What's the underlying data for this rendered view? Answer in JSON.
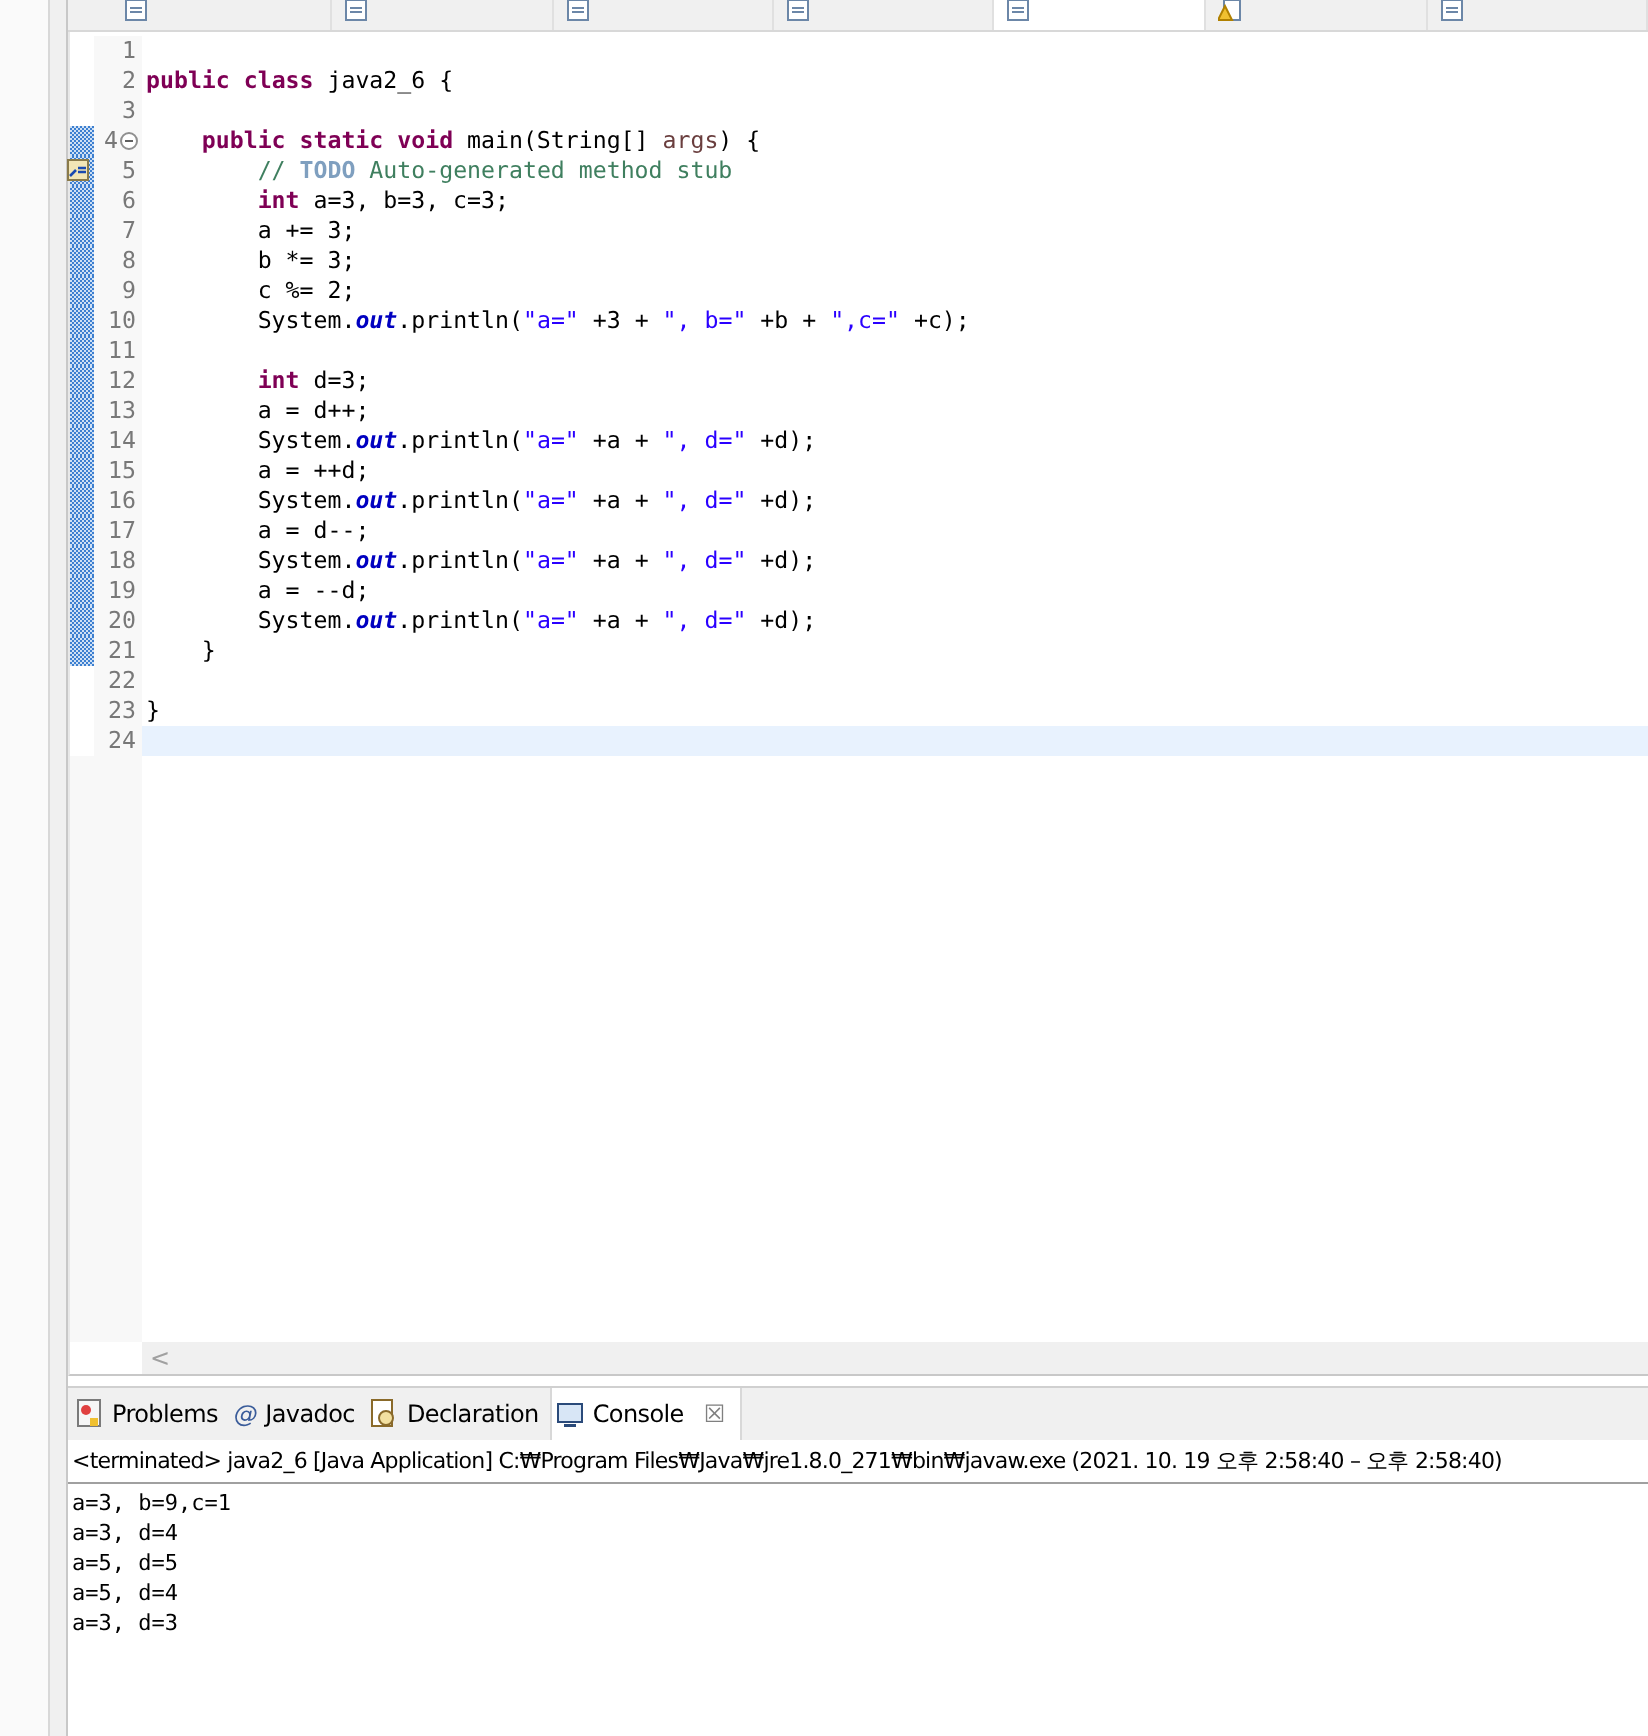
{
  "editor_tabs": [
    {
      "kind": "file",
      "selected": false
    },
    {
      "kind": "file",
      "selected": false
    },
    {
      "kind": "file",
      "selected": false
    },
    {
      "kind": "file",
      "selected": false
    },
    {
      "kind": "file",
      "selected": true
    },
    {
      "kind": "warning",
      "selected": false
    },
    {
      "kind": "file",
      "selected": false
    }
  ],
  "editor": {
    "lines": [
      {
        "number": "1",
        "changed": false,
        "current": false
      },
      {
        "number": "2",
        "changed": false,
        "current": false,
        "segments": [
          {
            "kind": "keyword",
            "text": "public class"
          },
          {
            "kind": "plain",
            "text": " java2_6 {"
          }
        ],
        "children": [
          {
            "number": "3",
            "changed": false,
            "current": false
          },
          {
            "number": "4",
            "changed": true,
            "current": false,
            "expanded": true,
            "segments": [
              {
                "kind": "keyword",
                "text": "public static void"
              },
              {
                "kind": "plain",
                "text": " main(String[] "
              },
              {
                "kind": "param",
                "text": "args"
              },
              {
                "kind": "plain",
                "text": ") {"
              }
            ],
            "children": [
              {
                "number": "5",
                "changed": true,
                "current": false,
                "task": true,
                "segments": [
                  {
                    "kind": "comment",
                    "text": "// "
                  },
                  {
                    "kind": "todo",
                    "text": "TODO"
                  },
                  {
                    "kind": "comment",
                    "text": " Auto-generated method stub"
                  }
                ]
              },
              {
                "number": "6",
                "changed": true,
                "current": false,
                "segments": [
                  {
                    "kind": "keyword",
                    "text": "int"
                  },
                  {
                    "kind": "plain",
                    "text": " a=3, b=3, c=3;"
                  }
                ]
              },
              {
                "number": "7",
                "changed": true,
                "current": false,
                "segments": [
                  {
                    "kind": "plain",
                    "text": "a += 3;"
                  }
                ]
              },
              {
                "number": "8",
                "changed": true,
                "current": false,
                "segments": [
                  {
                    "kind": "plain",
                    "text": "b *= 3;"
                  }
                ]
              },
              {
                "number": "9",
                "changed": true,
                "current": false,
                "segments": [
                  {
                    "kind": "plain",
                    "text": "c %= 2;"
                  }
                ]
              },
              {
                "number": "10",
                "changed": true,
                "current": false,
                "segments": [
                  {
                    "kind": "plain",
                    "text": "System."
                  },
                  {
                    "kind": "field",
                    "text": "out"
                  },
                  {
                    "kind": "plain",
                    "text": ".println("
                  },
                  {
                    "kind": "string",
                    "text": "\"a=\""
                  },
                  {
                    "kind": "plain",
                    "text": " +3 + "
                  },
                  {
                    "kind": "string",
                    "text": "\", b=\""
                  },
                  {
                    "kind": "plain",
                    "text": " +b + "
                  },
                  {
                    "kind": "string",
                    "text": "\",c=\""
                  },
                  {
                    "kind": "plain",
                    "text": " +c);"
                  }
                ]
              },
              {
                "number": "11",
                "changed": true,
                "current": false
              },
              {
                "number": "12",
                "changed": true,
                "current": false,
                "segments": [
                  {
                    "kind": "keyword",
                    "text": "int"
                  },
                  {
                    "kind": "plain",
                    "text": " d=3;"
                  }
                ]
              },
              {
                "number": "13",
                "changed": true,
                "current": false,
                "segments": [
                  {
                    "kind": "plain",
                    "text": "a = d++;"
                  }
                ]
              },
              {
                "number": "14",
                "changed": true,
                "current": false,
                "segments": [
                  {
                    "kind": "plain",
                    "text": "System."
                  },
                  {
                    "kind": "field",
                    "text": "out"
                  },
                  {
                    "kind": "plain",
                    "text": ".println("
                  },
                  {
                    "kind": "string",
                    "text": "\"a=\""
                  },
                  {
                    "kind": "plain",
                    "text": " +a + "
                  },
                  {
                    "kind": "string",
                    "text": "\", d=\""
                  },
                  {
                    "kind": "plain",
                    "text": " +d);"
                  }
                ]
              },
              {
                "number": "15",
                "changed": true,
                "current": false,
                "segments": [
                  {
                    "kind": "plain",
                    "text": "a = ++d;"
                  }
                ]
              },
              {
                "number": "16",
                "changed": true,
                "current": false,
                "segments": [
                  {
                    "kind": "plain",
                    "text": "System."
                  },
                  {
                    "kind": "field",
                    "text": "out"
                  },
                  {
                    "kind": "plain",
                    "text": ".println("
                  },
                  {
                    "kind": "string",
                    "text": "\"a=\""
                  },
                  {
                    "kind": "plain",
                    "text": " +a + "
                  },
                  {
                    "kind": "string",
                    "text": "\", d=\""
                  },
                  {
                    "kind": "plain",
                    "text": " +d);"
                  }
                ]
              },
              {
                "number": "17",
                "changed": true,
                "current": false,
                "segments": [
                  {
                    "kind": "plain",
                    "text": "a = d--;"
                  }
                ]
              },
              {
                "number": "18",
                "changed": true,
                "current": false,
                "segments": [
                  {
                    "kind": "plain",
                    "text": "System."
                  },
                  {
                    "kind": "field",
                    "text": "out"
                  },
                  {
                    "kind": "plain",
                    "text": ".println("
                  },
                  {
                    "kind": "string",
                    "text": "\"a=\""
                  },
                  {
                    "kind": "plain",
                    "text": " +a + "
                  },
                  {
                    "kind": "string",
                    "text": "\", d=\""
                  },
                  {
                    "kind": "plain",
                    "text": " +d);"
                  }
                ]
              },
              {
                "number": "19",
                "changed": true,
                "current": false,
                "segments": [
                  {
                    "kind": "plain",
                    "text": "a = --d;"
                  }
                ]
              },
              {
                "number": "20",
                "changed": true,
                "current": false,
                "segments": [
                  {
                    "kind": "plain",
                    "text": "System."
                  },
                  {
                    "kind": "field",
                    "text": "out"
                  },
                  {
                    "kind": "plain",
                    "text": ".println("
                  },
                  {
                    "kind": "string",
                    "text": "\"a=\""
                  },
                  {
                    "kind": "plain",
                    "text": " +a + "
                  },
                  {
                    "kind": "string",
                    "text": "\", d=\""
                  },
                  {
                    "kind": "plain",
                    "text": " +d);"
                  }
                ]
              }
            ]
          },
          {
            "number": "21",
            "changed": true,
            "current": false,
            "segments": [
              {
                "kind": "plain",
                "text": "}"
              }
            ]
          },
          {
            "number": "22",
            "changed": false,
            "current": false
          }
        ]
      },
      {
        "number": "23",
        "changed": false,
        "current": false,
        "segments": [
          {
            "kind": "plain",
            "text": "}"
          }
        ]
      },
      {
        "number": "24",
        "changed": false,
        "current": true
      }
    ],
    "scroll_left": "<"
  },
  "views": {
    "tabs": [
      {
        "label": "Problems",
        "selected": false
      },
      {
        "glyph": "@",
        "label": "Javadoc",
        "selected": false
      },
      {
        "label": "Declaration",
        "selected": false
      },
      {
        "label": "Console",
        "selected": true,
        "close": "☒"
      }
    ],
    "status": "<terminated> java2_6 [Java Application] C:₩Program Files₩Java₩jre1.8.0_271₩bin₩javaw.exe  (2021. 10. 19 오후 2:58:40 – 오후 2:58:40)",
    "output": [
      "a=3, b=9,c=1",
      "a=3, d=4",
      "a=5, d=5",
      "a=5, d=4",
      "a=3, d=3"
    ]
  }
}
